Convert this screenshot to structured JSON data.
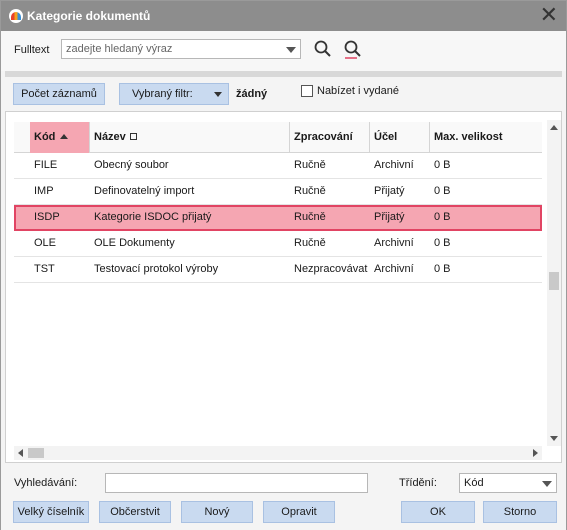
{
  "window": {
    "title": "Kategorie dokumentů"
  },
  "fulltext": {
    "label": "Fulltext",
    "placeholder": "zadejte hledaný výraz"
  },
  "filterbar": {
    "count_button": "Počet záznamů",
    "filter_button": "Vybraný filtr:",
    "filter_value": "žádný",
    "checkbox_label": "Nabízet i vydané",
    "checkbox_checked": false
  },
  "table": {
    "columns": [
      "Kód",
      "Název",
      "Zpracování",
      "Účel",
      "Max. velikost"
    ],
    "rows": [
      [
        "FILE",
        "Obecný soubor",
        "Ručně",
        "Archivní",
        "0 B"
      ],
      [
        "IMP",
        "Definovatelný import",
        "Ručně",
        "Přijatý",
        "0 B"
      ],
      [
        "ISDP",
        "Kategorie ISDOC přijatý",
        "Ručně",
        "Přijatý",
        "0 B"
      ],
      [
        "OLE",
        "OLE Dokumenty",
        "Ručně",
        "Archivní",
        "0 B"
      ],
      [
        "TST",
        "Testovací protokol výroby",
        "Nezpracovávat",
        "Archivní",
        "0 B"
      ]
    ],
    "selected_index": 2
  },
  "bottom": {
    "search_label": "Vyhledávání:",
    "sort_label": "Třídění:",
    "sort_value": "Kód",
    "buttons": {
      "big_list": "Velký číselník",
      "refresh": "Občerstvit",
      "new": "Nový",
      "edit": "Opravit",
      "ok": "OK",
      "cancel": "Storno"
    }
  }
}
